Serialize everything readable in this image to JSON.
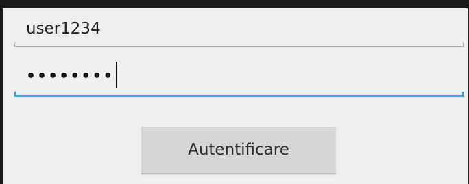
{
  "form": {
    "username": {
      "value": "user1234",
      "underline_color": "#a9a9a9"
    },
    "password": {
      "masked_value": "••••••••",
      "focused": true,
      "accent_color": "#2fa3d9"
    },
    "login_button": {
      "label": "Autentificare"
    }
  }
}
